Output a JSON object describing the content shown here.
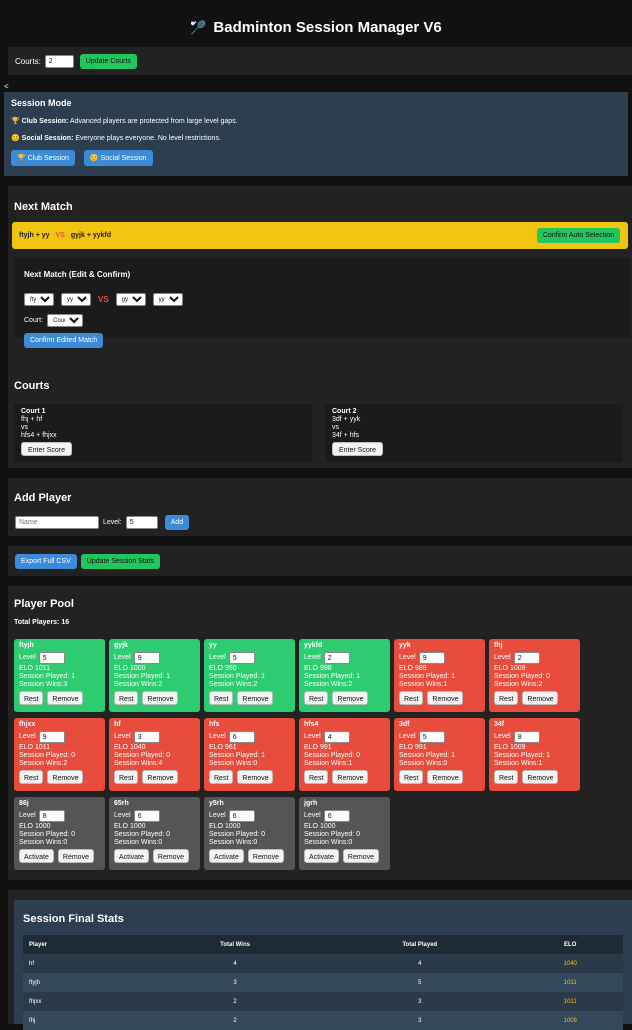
{
  "app": {
    "title": "Badminton Session Manager V6",
    "icon": "badminton-racket-icon"
  },
  "courts_setting": {
    "label": "Courts:",
    "value": "2",
    "button": "Update Courts"
  },
  "collapse_glyph": "<",
  "session_mode": {
    "title": "Session Mode",
    "club_name": "Club Session:",
    "club_desc": "Advanced players are protected from large level gaps.",
    "social_name": "Social Session:",
    "social_desc": "Everyone plays everyone. No level restrictions.",
    "club_button": "Club Session",
    "social_button": "Social Session"
  },
  "next_match": {
    "title": "Next Match",
    "team_a": "ftyjh + yy",
    "vs": "VS",
    "team_b": "gyjk + yykfd",
    "confirm_auto": "Confirm Auto Selection",
    "edit_title": "Next Match (Edit & Confirm)",
    "p1": "ftyjh",
    "p2": "yy",
    "p3": "gyjk",
    "p4": "yykfd",
    "court_label": "Court:",
    "court_value": "Court 1",
    "confirm_edited": "Confirm Edited Match"
  },
  "courts": {
    "title": "Courts",
    "list": [
      {
        "name": "Court 1",
        "team_a": "fhj + hf",
        "vs": "vs",
        "team_b": "hfs4 + fhjxx",
        "button": "Enter Score"
      },
      {
        "name": "Court 2",
        "team_a": "3df + yyk",
        "vs": "vs",
        "team_b": "34f + hfs",
        "button": "Enter Score"
      }
    ]
  },
  "add_player": {
    "title": "Add Player",
    "name_placeholder": "Name",
    "level_label": "Level:",
    "level_value": "5",
    "button": "Add"
  },
  "actions": {
    "export": "Export Full CSV",
    "update_stats": "Update Session Stats"
  },
  "pool": {
    "title": "Player Pool",
    "total": "Total Players: 16",
    "level_label": "Level",
    "players": [
      {
        "name": "ftyjh",
        "level": "5",
        "elo": "ELO 1011",
        "played": "Session Played: 1",
        "wins": "Session Wins:3",
        "b1": "Rest",
        "b2": "Remove",
        "state": "active"
      },
      {
        "name": "gyjk",
        "level": "9",
        "elo": "ELO 1000",
        "played": "Session Played: 1",
        "wins": "Session Wins:2",
        "b1": "Rest",
        "b2": "Remove",
        "state": "active"
      },
      {
        "name": "yy",
        "level": "5",
        "elo": "ELO 990",
        "played": "Session Played: 1",
        "wins": "Session Wins:2",
        "b1": "Rest",
        "b2": "Remove",
        "state": "active"
      },
      {
        "name": "yykfd",
        "level": "2",
        "elo": "ELO 998",
        "played": "Session Played: 1",
        "wins": "Session Wins:2",
        "b1": "Rest",
        "b2": "Remove",
        "state": "active"
      },
      {
        "name": "yyk",
        "level": "9",
        "elo": "ELO 989",
        "played": "Session Played: 1",
        "wins": "Session Wins:1",
        "b1": "Rest",
        "b2": "Remove",
        "state": "rest"
      },
      {
        "name": "fhj",
        "level": "2",
        "elo": "ELO 1009",
        "played": "Session Played: 0",
        "wins": "Session Wins:2",
        "b1": "Rest",
        "b2": "Remove",
        "state": "rest"
      },
      {
        "name": "fhjxx",
        "level": "9",
        "elo": "ELO 1011",
        "played": "Session Played: 0",
        "wins": "Session Wins:2",
        "b1": "Rest",
        "b2": "Remove",
        "state": "rest"
      },
      {
        "name": "hf",
        "level": "3",
        "elo": "ELO 1040",
        "played": "Session Played: 0",
        "wins": "Session Wins:4",
        "b1": "Rest",
        "b2": "Remove",
        "state": "rest"
      },
      {
        "name": "hfs",
        "level": "6",
        "elo": "ELO 961",
        "played": "Session Played: 1",
        "wins": "Session Wins:0",
        "b1": "Rest",
        "b2": "Remove",
        "state": "rest"
      },
      {
        "name": "hfs4",
        "level": "4",
        "elo": "ELO 991",
        "played": "Session Played: 0",
        "wins": "Session Wins:1",
        "b1": "Rest",
        "b2": "Remove",
        "state": "rest"
      },
      {
        "name": "3df",
        "level": "5",
        "elo": "ELO 991",
        "played": "Session Played: 1",
        "wins": "Session Wins:0",
        "b1": "Rest",
        "b2": "Remove",
        "state": "rest"
      },
      {
        "name": "34f",
        "level": "8",
        "elo": "ELO 1009",
        "played": "Session Played: 1",
        "wins": "Session Wins:1",
        "b1": "Rest",
        "b2": "Remove",
        "state": "rest"
      },
      {
        "name": "86j",
        "level": "8",
        "elo": "ELO 1000",
        "played": "Session Played: 0",
        "wins": "Session Wins:0",
        "b1": "Activate",
        "b2": "Remove",
        "state": "inactive"
      },
      {
        "name": "65rh",
        "level": "6",
        "elo": "ELO 1000",
        "played": "Session Played: 0",
        "wins": "Session Wins:0",
        "b1": "Activate",
        "b2": "Remove",
        "state": "inactive"
      },
      {
        "name": "y5rh",
        "level": "6",
        "elo": "ELO 1000",
        "played": "Session Played: 0",
        "wins": "Session Wins:0",
        "b1": "Activate",
        "b2": "Remove",
        "state": "inactive"
      },
      {
        "name": "jgrh",
        "level": "6",
        "elo": "ELO 1000",
        "played": "Session Played: 0",
        "wins": "Session Wins:0",
        "b1": "Activate",
        "b2": "Remove",
        "state": "inactive"
      }
    ]
  },
  "final_stats": {
    "title": "Session Final Stats",
    "headers": [
      "Player",
      "Total Wins",
      "Total Played",
      "ELO"
    ],
    "rows": [
      [
        "hf",
        "4",
        "4",
        "1040"
      ],
      [
        "ftyjh",
        "3",
        "5",
        "1011"
      ],
      [
        "fhjxx",
        "2",
        "3",
        "1011"
      ],
      [
        "fhj",
        "2",
        "3",
        "1009"
      ]
    ]
  },
  "colors": {
    "active": "#2ecc71",
    "rest": "#e74c3c",
    "inactive": "#555555",
    "match_bar": "#f1c40f",
    "panel_blue": "#2c3e50",
    "elo": "#f1c40f"
  }
}
